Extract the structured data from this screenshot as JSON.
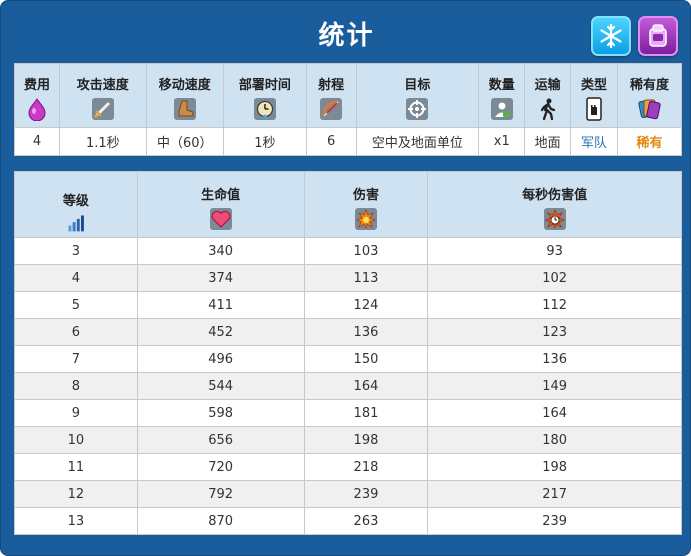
{
  "title": "统计",
  "stats": {
    "headers": [
      "费用",
      "攻击速度",
      "移动速度",
      "部署时间",
      "射程",
      "目标",
      "数量",
      "运输",
      "类型",
      "稀有度"
    ],
    "values": [
      "4",
      "1.1秒",
      "中（60）",
      "1秒",
      "6",
      "空中及地面单位",
      "x1",
      "地面",
      "军队",
      "稀有"
    ]
  },
  "levels": {
    "headers": [
      "等级",
      "生命值",
      "伤害",
      "每秒伤害值"
    ],
    "rows": [
      [
        "3",
        "340",
        "103",
        "93"
      ],
      [
        "4",
        "374",
        "113",
        "102"
      ],
      [
        "5",
        "411",
        "124",
        "112"
      ],
      [
        "6",
        "452",
        "136",
        "123"
      ],
      [
        "7",
        "496",
        "150",
        "136"
      ],
      [
        "8",
        "544",
        "164",
        "149"
      ],
      [
        "9",
        "598",
        "181",
        "164"
      ],
      [
        "10",
        "656",
        "198",
        "180"
      ],
      [
        "11",
        "720",
        "218",
        "198"
      ],
      [
        "12",
        "792",
        "239",
        "217"
      ],
      [
        "13",
        "870",
        "263",
        "239"
      ]
    ]
  },
  "icons": {
    "badges": [
      "freeze-icon",
      "clone-icon"
    ],
    "stat_icons": [
      "elixir-icon",
      "sword-icon",
      "boot-icon",
      "clock-icon",
      "bow-icon",
      "target-icon",
      "count-icon",
      "walk-icon",
      "card-icon",
      "cards-icon"
    ],
    "level_icons": [
      "bars-icon",
      "heart-icon",
      "explosion-icon",
      "dps-icon"
    ]
  },
  "colors": {
    "header_bg": "#cfe2f1",
    "panel_bg": "#1a5d9c",
    "troop_link": "#2b73b8",
    "rare": "#e08a10"
  }
}
